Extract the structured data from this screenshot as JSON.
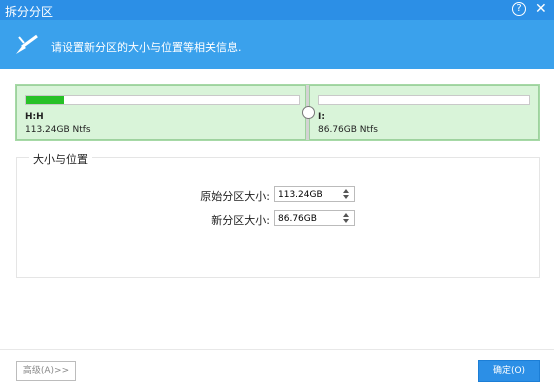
{
  "window": {
    "title": "拆分分区",
    "help_glyph": "?",
    "close_glyph": "✕"
  },
  "banner": {
    "message": "请设置新分区的大小与位置等相关信息."
  },
  "disk": {
    "partitions": [
      {
        "name": "H:H",
        "size_text": "113.24GB Ntfs",
        "usage_fraction": 0.14
      },
      {
        "name": "I:",
        "size_text": "86.76GB Ntfs",
        "usage_fraction": 0.0
      }
    ]
  },
  "size_position": {
    "title": "大小与位置",
    "original_label": "原始分区大小:",
    "original_value": "113.24GB",
    "new_label": "新分区大小:",
    "new_value": "86.76GB"
  },
  "buttons": {
    "advanced": "高级(A)>>",
    "ok": "确定(O)"
  },
  "colors": {
    "titlebar": "#2c8fe6",
    "banner": "#3aa1ec",
    "partition": "#d9f4d9",
    "usage": "#27c127"
  }
}
